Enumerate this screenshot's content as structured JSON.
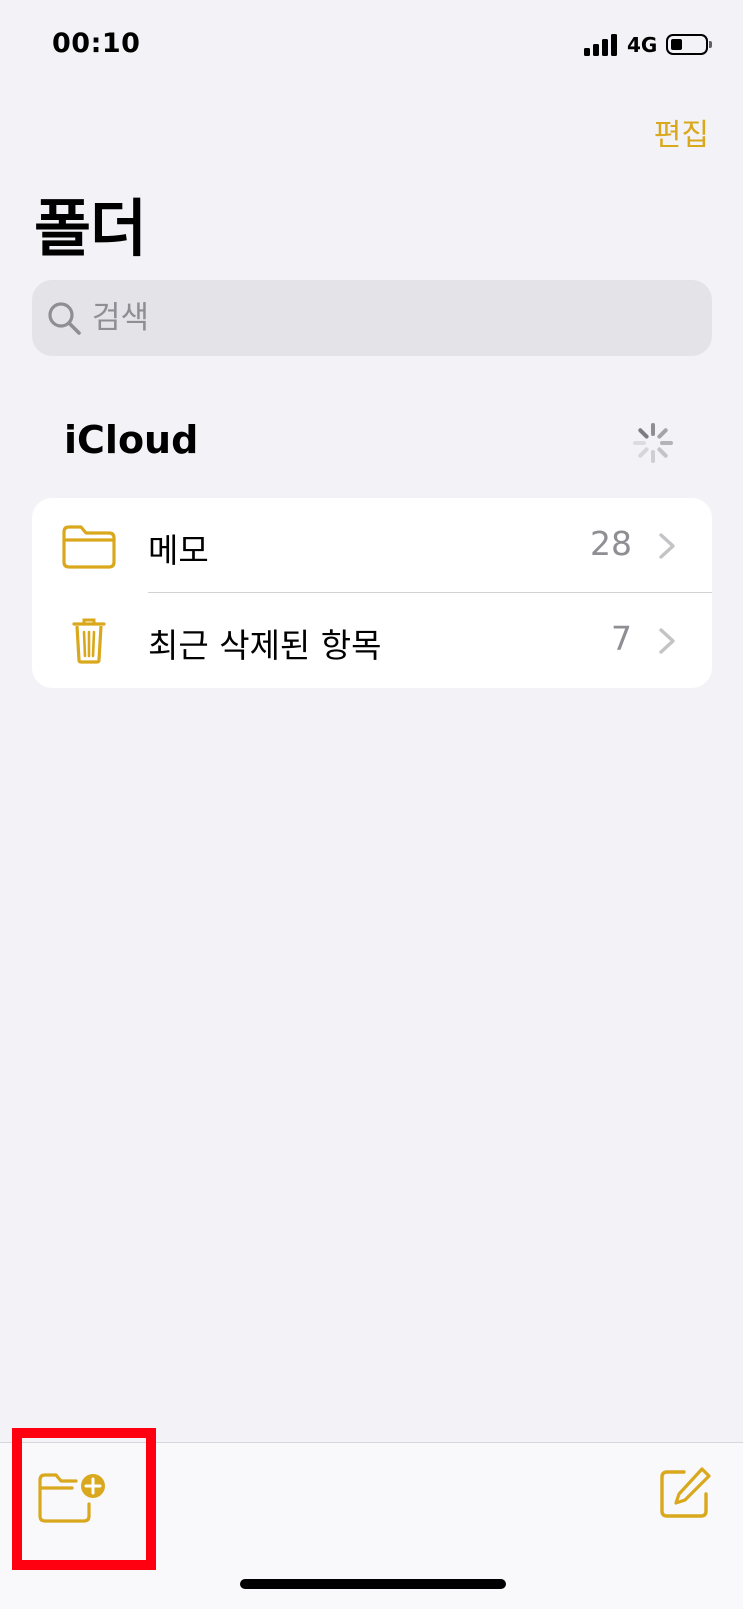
{
  "status_bar": {
    "time": "00:10",
    "network": "4G"
  },
  "header": {
    "edit_label": "편집",
    "title": "폴더"
  },
  "search": {
    "placeholder": "검색"
  },
  "section": {
    "title": "iCloud"
  },
  "folders": [
    {
      "label": "메모",
      "count": "28",
      "icon": "folder-icon"
    },
    {
      "label": "최근 삭제된 항목",
      "count": "7",
      "icon": "trash-icon"
    }
  ],
  "toolbar": {
    "left_icon": "new-folder-icon",
    "right_icon": "compose-icon"
  },
  "colors": {
    "accent": "#d9a81c",
    "background": "#f2f2f7",
    "highlight": "#ff0010"
  }
}
